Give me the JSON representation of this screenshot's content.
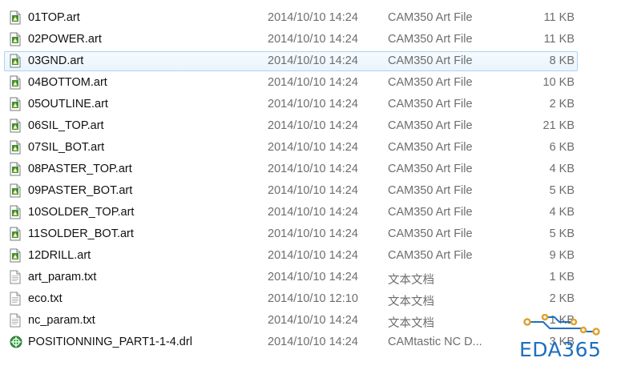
{
  "files": [
    {
      "name": "01TOP.art",
      "date": "2014/10/10 14:24",
      "type": "CAM350 Art File",
      "size": "11 KB",
      "icon": "cam350-art-file-icon"
    },
    {
      "name": "02POWER.art",
      "date": "2014/10/10 14:24",
      "type": "CAM350 Art File",
      "size": "11 KB",
      "icon": "cam350-art-file-icon"
    },
    {
      "name": "03GND.art",
      "date": "2014/10/10 14:24",
      "type": "CAM350 Art File",
      "size": "8 KB",
      "icon": "cam350-art-file-icon",
      "selected": true
    },
    {
      "name": "04BOTTOM.art",
      "date": "2014/10/10 14:24",
      "type": "CAM350 Art File",
      "size": "10 KB",
      "icon": "cam350-art-file-icon"
    },
    {
      "name": "05OUTLINE.art",
      "date": "2014/10/10 14:24",
      "type": "CAM350 Art File",
      "size": "2 KB",
      "icon": "cam350-art-file-icon"
    },
    {
      "name": "06SIL_TOP.art",
      "date": "2014/10/10 14:24",
      "type": "CAM350 Art File",
      "size": "21 KB",
      "icon": "cam350-art-file-icon"
    },
    {
      "name": "07SIL_BOT.art",
      "date": "2014/10/10 14:24",
      "type": "CAM350 Art File",
      "size": "6 KB",
      "icon": "cam350-art-file-icon"
    },
    {
      "name": "08PASTER_TOP.art",
      "date": "2014/10/10 14:24",
      "type": "CAM350 Art File",
      "size": "4 KB",
      "icon": "cam350-art-file-icon"
    },
    {
      "name": "09PASTER_BOT.art",
      "date": "2014/10/10 14:24",
      "type": "CAM350 Art File",
      "size": "5 KB",
      "icon": "cam350-art-file-icon"
    },
    {
      "name": "10SOLDER_TOP.art",
      "date": "2014/10/10 14:24",
      "type": "CAM350 Art File",
      "size": "4 KB",
      "icon": "cam350-art-file-icon"
    },
    {
      "name": "11SOLDER_BOT.art",
      "date": "2014/10/10 14:24",
      "type": "CAM350 Art File",
      "size": "5 KB",
      "icon": "cam350-art-file-icon"
    },
    {
      "name": "12DRILL.art",
      "date": "2014/10/10 14:24",
      "type": "CAM350 Art File",
      "size": "9 KB",
      "icon": "cam350-art-file-icon"
    },
    {
      "name": "art_param.txt",
      "date": "2014/10/10 14:24",
      "type": "文本文档",
      "size": "1 KB",
      "icon": "text-file-icon"
    },
    {
      "name": "eco.txt",
      "date": "2014/10/10 12:10",
      "type": "文本文档",
      "size": "2 KB",
      "icon": "text-file-icon"
    },
    {
      "name": "nc_param.txt",
      "date": "2014/10/10 14:24",
      "type": "文本文档",
      "size": "1 KB",
      "icon": "text-file-icon"
    },
    {
      "name": "POSITIONNING_PART1-1-4.drl",
      "date": "2014/10/10 14:24",
      "type": "CAMtastic NC D...",
      "size": "3 KB",
      "icon": "camtastic-drill-file-icon"
    }
  ],
  "watermark": {
    "text": "EDA365",
    "color": "#1f6fc0",
    "accent": "#e0a030"
  },
  "colors": {
    "selection_border": "#aed2f1",
    "selection_fill": "#eaf4fd",
    "meta_text": "#6d6d6d"
  }
}
